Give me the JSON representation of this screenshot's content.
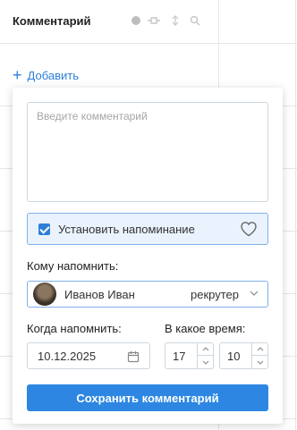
{
  "header": {
    "title": "Комментарий",
    "icons": [
      "settings-icon",
      "plug-icon",
      "sort-icon",
      "search-icon"
    ]
  },
  "add_link": {
    "label": "Добавить"
  },
  "form": {
    "comment_placeholder": "Введите комментарий",
    "reminder": {
      "label": "Установить напоминание",
      "checked": true
    },
    "who_label": "Кому напомнить:",
    "who": {
      "name": "Иванов Иван",
      "role": "рекрутер"
    },
    "when_label": "Когда напомнить:",
    "date": "10.12.2025",
    "time_label": "В какое время:",
    "hour": "17",
    "minute": "10",
    "save_label": "Сохранить комментарий"
  },
  "colors": {
    "accent": "#2d87e2",
    "highlight_bg": "#eaf3fd",
    "highlight_border": "#7fb1e8"
  }
}
